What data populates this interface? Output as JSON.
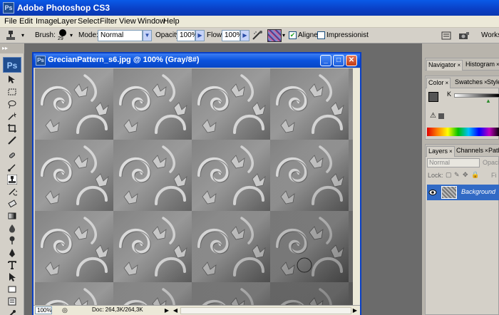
{
  "app": {
    "title": "Adobe Photoshop CS3",
    "logo": "Ps"
  },
  "menu": [
    "File",
    "Edit",
    "Image",
    "Layer",
    "Select",
    "Filter",
    "View",
    "Window",
    "Help"
  ],
  "options": {
    "brush_label": "Brush:",
    "brush_size": "29",
    "mode_label": "Mode:",
    "mode_value": "Normal",
    "opacity_label": "Opacity:",
    "opacity_value": "100%",
    "flow_label": "Flow:",
    "flow_value": "100%",
    "aligned_label": "Aligned",
    "aligned_checked": true,
    "impressionist_label": "Impressionist",
    "impressionist_checked": false,
    "workspace_label": "Worksp"
  },
  "toolbox": {
    "badge": "Ps"
  },
  "document": {
    "title": "GrecianPattern_s6.jpg @ 100% (Gray/8#)",
    "zoom": "100%",
    "doc_info": "Doc: 264,3K/264,3K"
  },
  "panels": {
    "top_tabs": [
      "Navigator",
      "Histogram"
    ],
    "color_tabs": [
      "Color",
      "Swatches",
      "Style"
    ],
    "color_channel": "K",
    "layers_tabs": [
      "Layers",
      "Channels",
      "Path"
    ],
    "blend_mode": "Normal",
    "opacity_label": "Opaci",
    "lock_label": "Lock:",
    "fill_label": "Fi",
    "layer_name": "Background"
  },
  "colors": {
    "titlebar": "#0a3fc4",
    "chrome": "#d4d0c8",
    "workspace": "#6b6b6b",
    "selected_layer": "#316ac5"
  }
}
